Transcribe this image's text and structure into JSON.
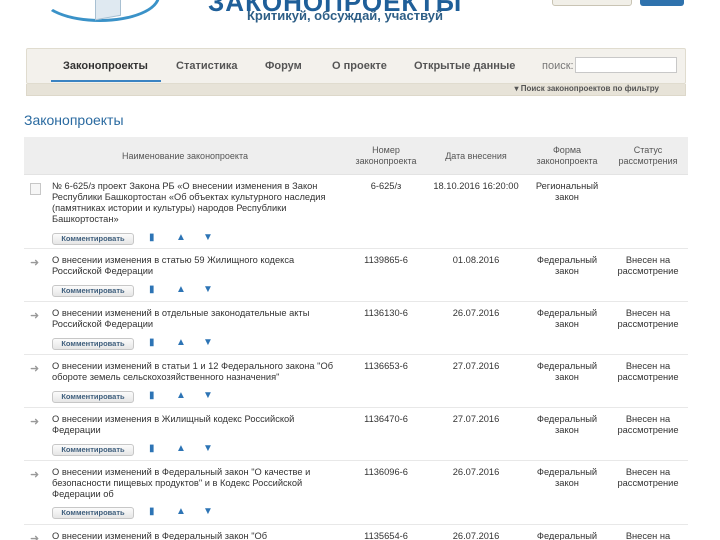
{
  "header": {
    "site_title": "ЗАКОНОПРОЕКТЫ",
    "slogan": "Критикуй, обсуждай, участвуй"
  },
  "nav": {
    "items": [
      {
        "label": "Законопроекты",
        "active": true
      },
      {
        "label": "Статистика"
      },
      {
        "label": "Форум"
      },
      {
        "label": "О проекте"
      },
      {
        "label": "Открытые данные"
      }
    ],
    "search_label": "поиск:",
    "search_value": "",
    "filter_link": "▾ Поиск законопроектов по фильтру"
  },
  "section_title": "Законопроекты",
  "table": {
    "headers": {
      "name": "Наименование законопроекта",
      "number": "Номер законопроекта",
      "date": "Дата внесения",
      "form": "Форма законопроекта",
      "status": "Статус рассмотрения"
    },
    "comment_label": "Комментировать",
    "icons": {
      "comment": "speech-bubble-icon",
      "like": "thumbs-up-icon",
      "dislike": "thumbs-down-icon",
      "row": "arrow-right-icon",
      "broken": "broken-image-icon"
    },
    "rows": [
      {
        "title": "№ 6-625/з проект Закона РБ «О внесении изменения в Закон Республики Башкортостан «Об объектах культурного наследия (памятниках истории и культуры) народов Республики Башкортостан»",
        "number": "6-625/з",
        "date": "18.10.2016 16:20:00",
        "form": "Региональный закон",
        "status": ""
      },
      {
        "title": "О внесении изменения в статью 59 Жилищного кодекса Российской Федерации",
        "number": "1139865-6",
        "date": "01.08.2016",
        "form": "Федеральный закон",
        "status": "Внесен на рассмотрение"
      },
      {
        "title": "О внесении изменений в отдельные законодательные акты Российской Федерации",
        "number": "1136130-6",
        "date": "26.07.2016",
        "form": "Федеральный закон",
        "status": "Внесен на рассмотрение"
      },
      {
        "title": "О внесении изменений в статьи 1 и 12 Федерального закона \"Об обороте земель сельскохозяйственного назначения\"",
        "number": "1136653-6",
        "date": "27.07.2016",
        "form": "Федеральный закон",
        "status": "Внесен на рассмотрение"
      },
      {
        "title": "О внесении изменения в Жилищный кодекс Российской Федерации",
        "number": "1136470-6",
        "date": "27.07.2016",
        "form": "Федеральный закон",
        "status": "Внесен на рассмотрение"
      },
      {
        "title": "О внесении изменений в Федеральный закон \"О качестве и безопасности пищевых продуктов\" и в Кодекс Российской Федерации об",
        "number": "1136096-6",
        "date": "26.07.2016",
        "form": "Федеральный закон",
        "status": "Внесен на рассмотрение"
      },
      {
        "title": "О внесении изменений в Федеральный закон \"Об",
        "number": "1135654-6",
        "date": "26.07.2016",
        "form": "Федеральный",
        "status": "Внесен на"
      }
    ]
  }
}
